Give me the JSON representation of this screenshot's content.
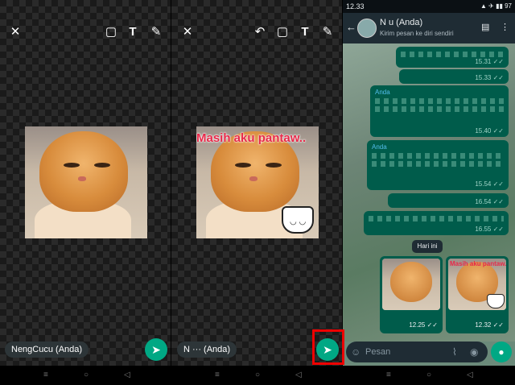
{
  "editor_left": {
    "close_icon": "✕",
    "sticker_icon": "▢",
    "text_icon": "T",
    "pen_icon": "✎",
    "recipient": "NengCucu (Anda)",
    "send_icon": "➤"
  },
  "editor_right": {
    "close_icon": "✕",
    "undo_icon": "↶",
    "sticker_icon": "▢",
    "text_icon": "T",
    "pen_icon": "✎",
    "sticker_caption": "Masih aku pantaw..",
    "cup_face": "◡ ◡",
    "recipient": "N          ··· (Anda)",
    "send_icon": "➤"
  },
  "chat": {
    "status_time": "12.33",
    "status_right": "▲ ✈ ▮▮ 97",
    "back_icon": "←",
    "contact_name": "N   u (Anda)",
    "contact_subtitle": "Kirim pesan ke diri sendiri",
    "menu_icon": "⋮",
    "store_icon": "▤",
    "messages": [
      {
        "sender": "",
        "time": "15.31 ✓✓"
      },
      {
        "sender": "",
        "time": "15.33 ✓✓"
      },
      {
        "sender": "Anda",
        "time": "15.40 ✓✓"
      },
      {
        "sender": "Anda",
        "time": "15.54 ✓✓"
      },
      {
        "sender": "",
        "time": "16.54 ✓✓"
      },
      {
        "sender": "",
        "time": "16.55 ✓✓"
      }
    ],
    "day_divider": "Hari ini",
    "image_messages": [
      {
        "time": "12.25 ✓✓",
        "caption": ""
      },
      {
        "time": "12.32 ✓✓",
        "caption": "Masih aku pantaw.."
      }
    ],
    "composer_placeholder": "Pesan",
    "emoji_icon": "☺",
    "attach_icon": "⌇",
    "camera_icon": "◉",
    "mic_icon": "●"
  },
  "navbar": {
    "home_icon": "○",
    "menu_icon": "≡",
    "back_icon": "◁"
  },
  "colors": {
    "accent": "#00a884",
    "bubble": "#005c4b",
    "highlight": "#ee0000"
  }
}
